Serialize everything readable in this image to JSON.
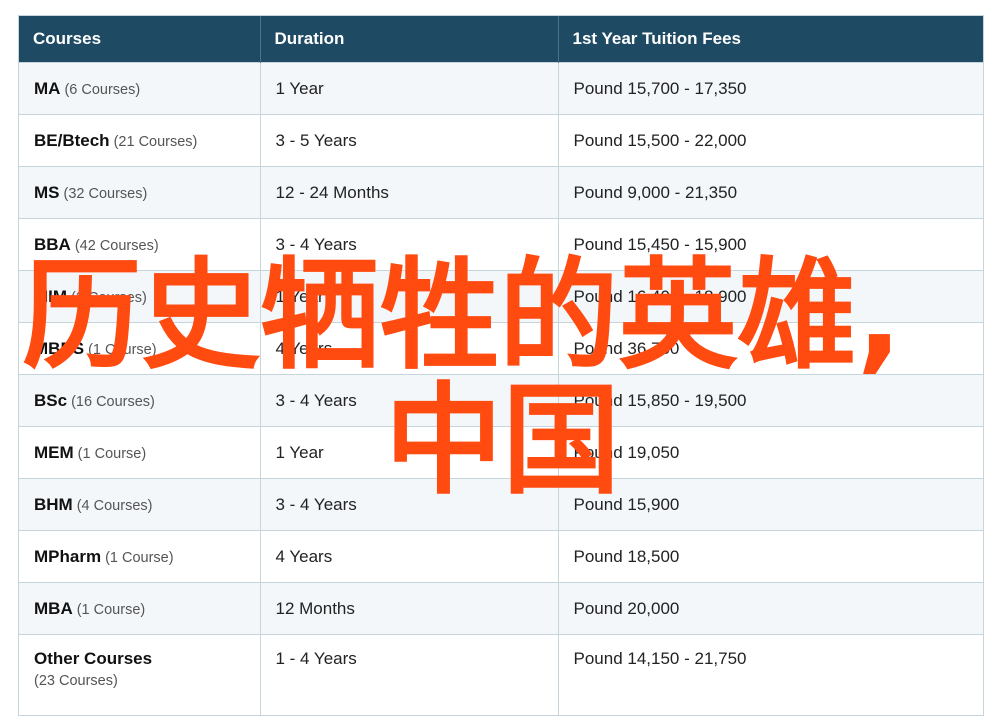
{
  "table": {
    "headers": [
      "Courses",
      "Duration",
      "1st Year Tuition Fees"
    ],
    "rows": [
      {
        "course": "MA",
        "count": "(6 Courses)",
        "duration": "1 Year",
        "fees": "Pound 15,700 - 17,350"
      },
      {
        "course": "BE/Btech",
        "count": "(21 Courses)",
        "duration": "3 - 5 Years",
        "fees": "Pound 15,500 - 22,000"
      },
      {
        "course": "MS",
        "count": "(32 Courses)",
        "duration": "12 - 24 Months",
        "fees": "Pound 9,000 - 21,350"
      },
      {
        "course": "BBA",
        "count": "(42 Courses)",
        "duration": "3 - 4 Years",
        "fees": "Pound 15,450 - 15,900"
      },
      {
        "course": "MIM",
        "count": "(2 Courses)",
        "duration": "1 Year",
        "fees": "Pound 16,400 - 18,900"
      },
      {
        "course": "MBBS",
        "count": "(1 Course)",
        "duration": "4 Years",
        "fees": "Pound 36,750"
      },
      {
        "course": "BSc",
        "count": "(16 Courses)",
        "duration": "3 - 4 Years",
        "fees": "Pound 15,850 - 19,500"
      },
      {
        "course": "MEM",
        "count": "(1 Course)",
        "duration": "1 Year",
        "fees": "Pound 19,050"
      },
      {
        "course": "BHM",
        "count": "(4 Courses)",
        "duration": "3 - 4 Years",
        "fees": "Pound 15,900"
      },
      {
        "course": "MPharm",
        "count": "(1 Course)",
        "duration": "4 Years",
        "fees": "Pound 18,500"
      },
      {
        "course": "MBA",
        "count": "(1 Course)",
        "duration": "12 Months",
        "fees": "Pound 20,000"
      },
      {
        "course": "Other Courses",
        "count": "(23 Courses)",
        "duration": "1 - 4 Years",
        "fees": "Pound 14,150 - 21,750"
      }
    ]
  },
  "watermark": {
    "line1": "历史牺牲的英雄,",
    "line2": "中国",
    "color": "#ff4a10"
  }
}
